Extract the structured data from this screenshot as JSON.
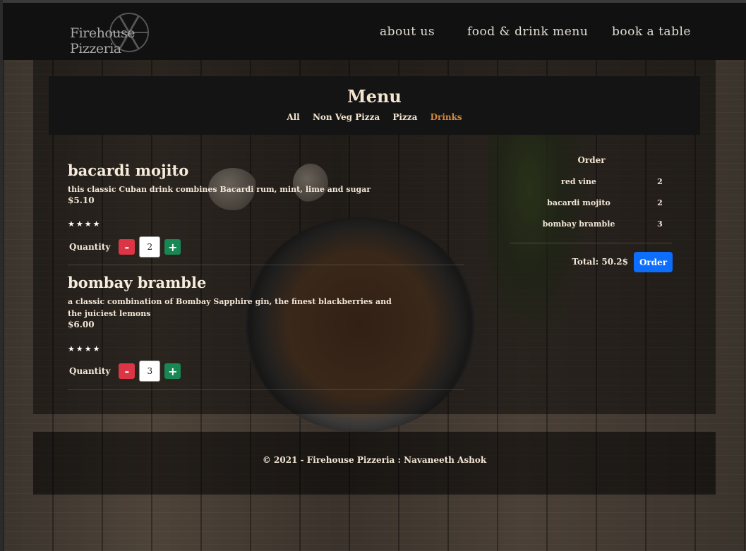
{
  "brand": {
    "name": "Firehouse Pizzeria",
    "logo_icon": "pizza-wheel-icon"
  },
  "nav": {
    "links": [
      "about us",
      "food & drink menu",
      "book a table"
    ]
  },
  "menu": {
    "title": "Menu",
    "categories": [
      "All",
      "Non Veg Pizza",
      "Pizza",
      "Drinks"
    ],
    "active_category": "Drinks",
    "quantity_label": "Quantity",
    "items": [
      {
        "name": "bacardi mojito",
        "description": "this classic Cuban drink combines Bacardi rum, mint, lime and sugar",
        "price": "$5.10",
        "rating_display": "★★★★",
        "rating": 4,
        "quantity": "2"
      },
      {
        "name": "bombay bramble",
        "description": "a classic combination of Bombay Sapphire gin, the finest blackberries and the juiciest lemons",
        "price": "$6.00",
        "rating_display": "★★★★",
        "rating": 4,
        "quantity": "3"
      }
    ]
  },
  "order": {
    "title": "Order",
    "items": [
      {
        "name": "red vine",
        "qty": "2"
      },
      {
        "name": "bacardi mojito",
        "qty": "2"
      },
      {
        "name": "bombay bramble",
        "qty": "3"
      }
    ],
    "total": "Total: 50.2$",
    "button_label": "Order"
  },
  "footer": {
    "text": "© 2021 - Firehouse Pizzeria : Navaneeth Ashok"
  },
  "colors": {
    "navbar_bg": "#111111",
    "accent_active_tab": "#d4893a",
    "minus_button": "#dc3545",
    "plus_button": "#198754",
    "order_button": "#0d6efd",
    "text_cream": "#f3e4cf"
  }
}
